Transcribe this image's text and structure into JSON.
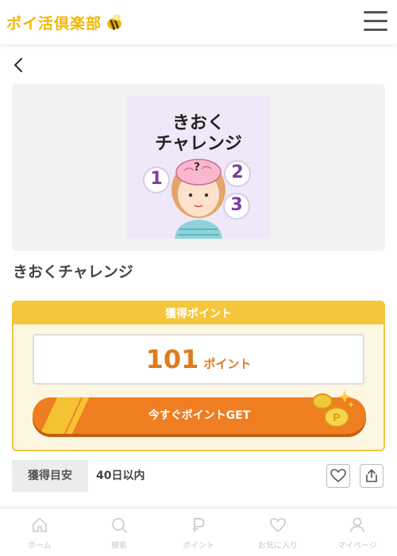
{
  "header": {
    "logo_text": "ポイ活倶楽部"
  },
  "thumbnail": {
    "title_line1": "きおく",
    "title_line2": "チャレンジ",
    "numbers": [
      "1",
      "2",
      "3"
    ],
    "question_mark": "?"
  },
  "page_title": "きおくチャレンジ",
  "points": {
    "header_label": "獲得ポイント",
    "value": "101",
    "unit": "ポイント",
    "button_label": "今すぐポイントGET"
  },
  "estimate": {
    "label": "獲得目安",
    "value": "40日以内"
  },
  "bottom_nav": [
    {
      "label": "ホーム",
      "icon": "home-icon"
    },
    {
      "label": "検索",
      "icon": "search-icon"
    },
    {
      "label": "ポイント",
      "icon": "point-icon"
    },
    {
      "label": "お気に入り",
      "icon": "heart-icon"
    },
    {
      "label": "マイページ",
      "icon": "user-icon"
    }
  ],
  "colors": {
    "accent_orange": "#ef7e22",
    "accent_yellow": "#f3c63c",
    "points_text": "#e07a1f"
  }
}
